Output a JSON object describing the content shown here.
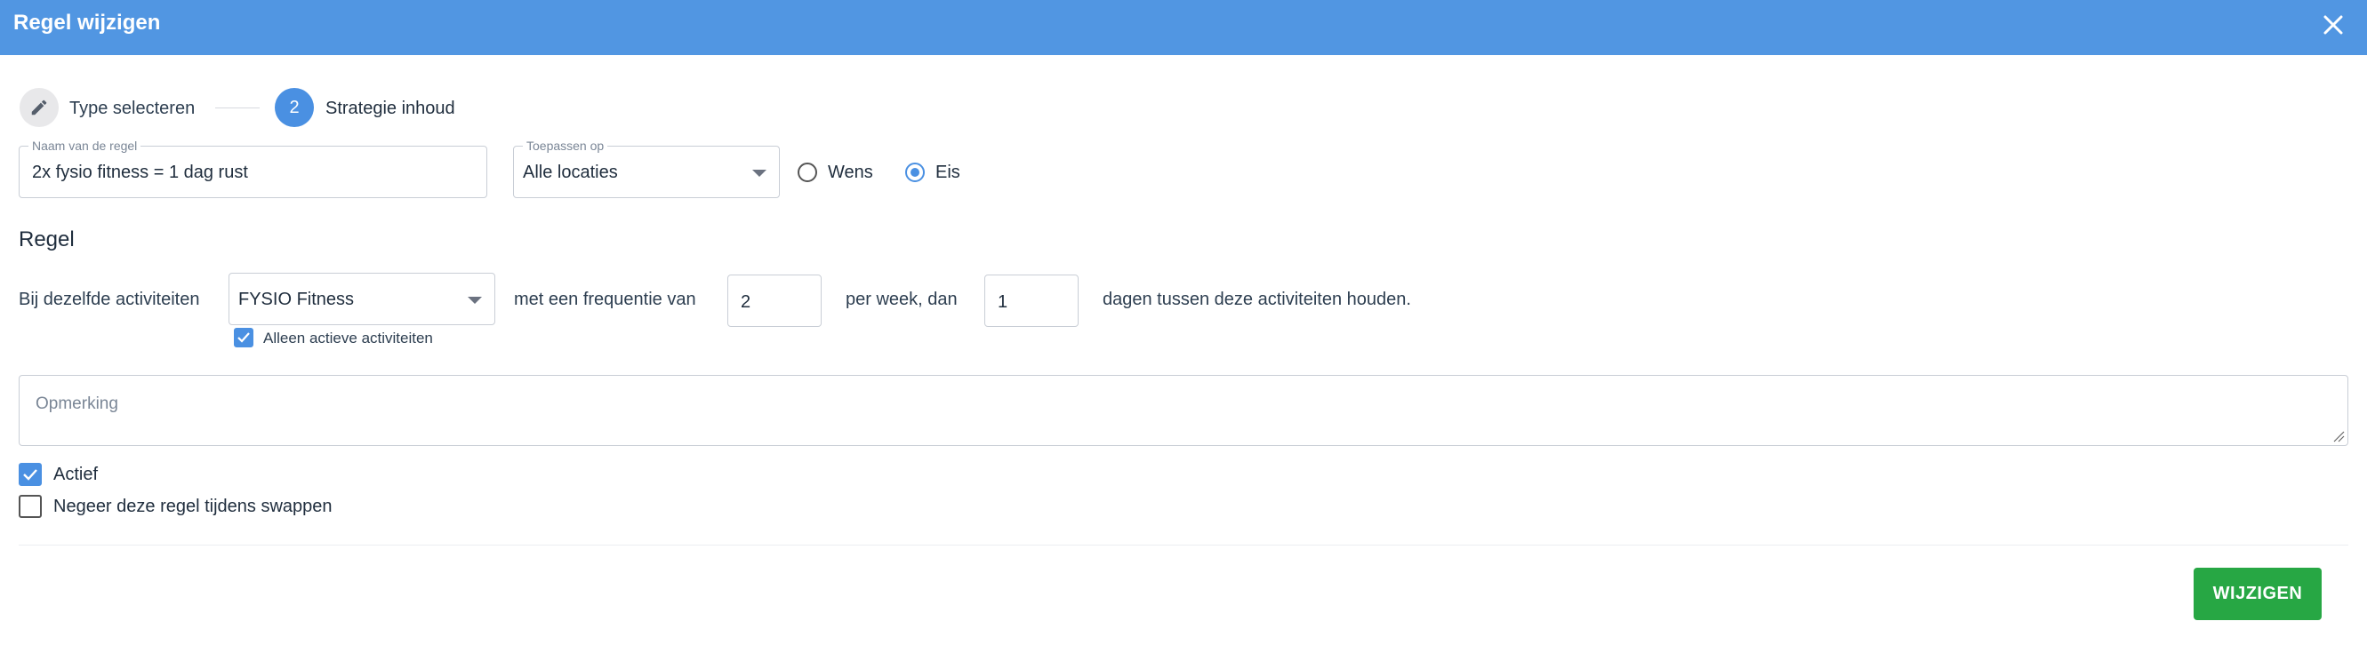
{
  "dialog": {
    "title": "Regel wijzigen",
    "colors": {
      "header": "#5196e2",
      "accent": "#4a90e2",
      "primary_button": "#27a744"
    }
  },
  "stepper": {
    "steps": [
      {
        "label": "Type selecteren",
        "icon": "pencil-icon",
        "state": "completed"
      },
      {
        "number": "2",
        "label": "Strategie inhoud",
        "state": "active"
      }
    ]
  },
  "form": {
    "rule_name": {
      "label": "Naam van de regel",
      "value": "2x fysio fitness = 1 dag rust"
    },
    "apply_to": {
      "label": "Toepassen op",
      "value": "Alle locaties"
    },
    "priority": {
      "options": [
        {
          "label": "Wens",
          "checked": false
        },
        {
          "label": "Eis",
          "checked": true
        }
      ]
    }
  },
  "rule": {
    "section_title": "Regel",
    "prefix_text": "Bij dezelfde activiteiten",
    "activity_select": {
      "value": "FYSIO Fitness"
    },
    "only_active": {
      "label": "Alleen actieve activiteiten",
      "checked": true
    },
    "frequency_text": "met een frequentie van",
    "frequency_value": "2",
    "per_week_text": "per week, dan",
    "days_value": "1",
    "suffix_text": "dagen tussen deze activiteiten houden."
  },
  "remark": {
    "placeholder": "Opmerking"
  },
  "options": {
    "active": {
      "label": "Actief",
      "checked": true
    },
    "ignore_swap": {
      "label": "Negeer deze regel tijdens swappen",
      "checked": false
    }
  },
  "footer": {
    "submit_label": "WIJZIGEN"
  }
}
